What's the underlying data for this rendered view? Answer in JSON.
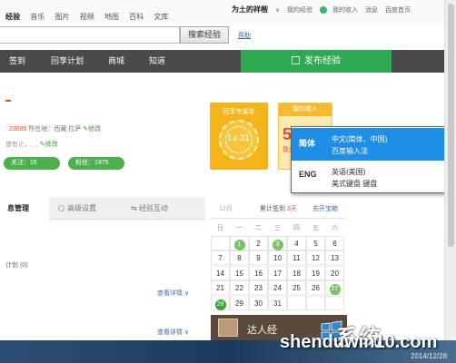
{
  "topbar": {
    "nav": [
      "经验",
      "音乐",
      "图片",
      "视频",
      "地图",
      "百科",
      "文库"
    ],
    "username": "为土的祥楷",
    "links": [
      "我的经验",
      "我的收入",
      "消息",
      "百度首页"
    ]
  },
  "search": {
    "button_label": "搜索经验",
    "help_label": "帮助"
  },
  "navbar": {
    "items": [
      "签到",
      "回享计划",
      "商城",
      "知道"
    ],
    "publish_label": "发布经验"
  },
  "profile": {
    "stats_count": "23095",
    "location_label": "所在地：西藏 拉萨",
    "edit_label": "修改",
    "signature_prefix": "使有止，, ,,",
    "follow_label": "关注：16",
    "fans_label": "粉丝：1975"
  },
  "level_card": {
    "title": "回享专属本",
    "level": "Lv.31"
  },
  "income_card": {
    "title": "我的收入",
    "value": "5",
    "sub": "现金"
  },
  "tabs": [
    {
      "label": "息管理"
    },
    {
      "label": "高级设置"
    },
    {
      "label": "经验互动"
    }
  ],
  "content": {
    "plan_label": "计划 (0)",
    "detail_label": "查看详情"
  },
  "calendar": {
    "month": "12月",
    "signed_prefix": "累计签到",
    "signed_days": "3天",
    "open_label": "去开宝箱",
    "weekdays": [
      "日",
      "一",
      "二",
      "三",
      "四",
      "五",
      "六"
    ],
    "weeks": [
      [
        "",
        "1",
        "2",
        "3",
        "4",
        "5",
        "6"
      ],
      [
        "7",
        "8",
        "9",
        "10",
        "11",
        "12",
        "13"
      ],
      [
        "14",
        "15",
        "16",
        "17",
        "18",
        "19",
        "20"
      ],
      [
        "21",
        "22",
        "23",
        "24",
        "25",
        "26",
        "27"
      ],
      [
        "28",
        "29",
        "30",
        "31",
        "",
        "",
        ""
      ]
    ],
    "marked_days": [
      "1",
      "3",
      "27"
    ],
    "today": "28"
  },
  "ad_banner": {
    "text": "达人经"
  },
  "ime_popup": {
    "items": [
      {
        "code": "简体",
        "lang": "中文(简体，中国)",
        "name": "百度输入法",
        "selected": true
      },
      {
        "code": "ENG",
        "lang": "英语(美国)",
        "name": "美式键盘 键盘",
        "selected": false
      }
    ]
  },
  "watermark": {
    "brand": "系统",
    "url": "shenduwin10.com",
    "date": "2014/12/28"
  },
  "colors": {
    "nav_bg": "#4a4a4a",
    "publish_green": "#2fa94f",
    "ime_highlight": "#1e8ee6",
    "accent_orange": "#e2512b"
  }
}
